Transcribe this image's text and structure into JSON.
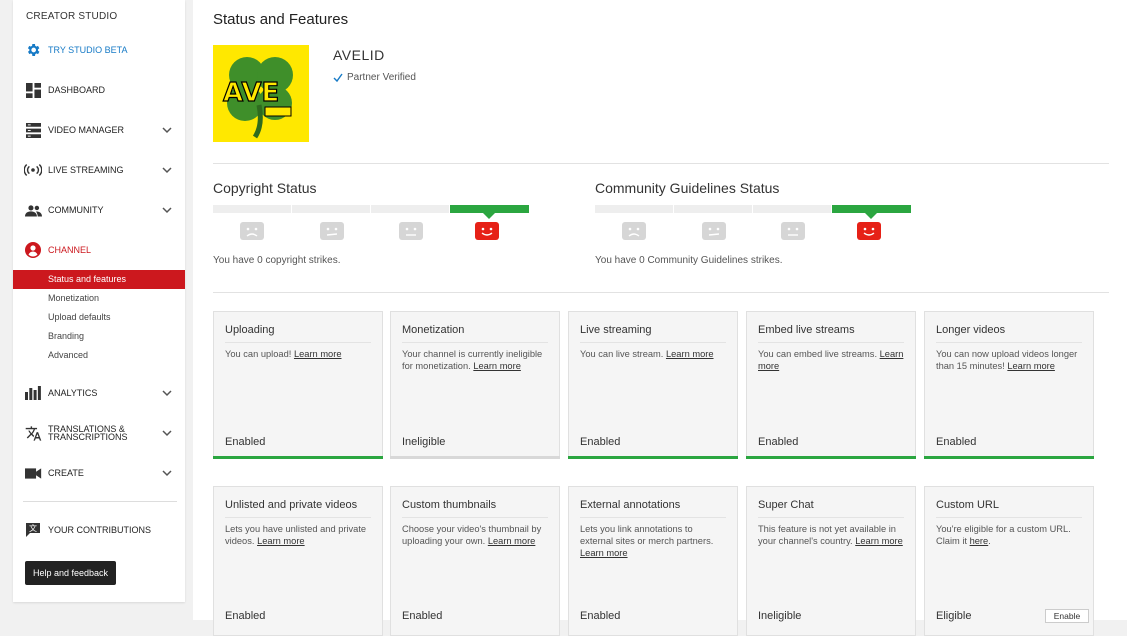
{
  "sidebar": {
    "title": "CREATOR STUDIO",
    "items": [
      {
        "label": "TRY STUDIO BETA",
        "icon": "gear-icon"
      },
      {
        "label": "DASHBOARD",
        "icon": "dashboard-icon"
      },
      {
        "label": "VIDEO MANAGER",
        "icon": "video-manager-icon"
      },
      {
        "label": "LIVE STREAMING",
        "icon": "live-icon"
      },
      {
        "label": "COMMUNITY",
        "icon": "community-icon"
      },
      {
        "label": "CHANNEL",
        "icon": "channel-icon"
      },
      {
        "label": "ANALYTICS",
        "icon": "analytics-icon"
      },
      {
        "label": "TRANSLATIONS &",
        "label2": "TRANSCRIPTIONS",
        "icon": "translate-icon"
      },
      {
        "label": "CREATE",
        "icon": "camera-icon"
      },
      {
        "label": "YOUR CONTRIBUTIONS",
        "icon": "contributions-icon"
      }
    ],
    "channel_sub": [
      "Status and features",
      "Monetization",
      "Upload defaults",
      "Branding",
      "Advanced"
    ],
    "help_label": "Help and feedback"
  },
  "main": {
    "title": "Status and Features",
    "channel_name": "AVELID",
    "verified": "Partner Verified",
    "logo_text": "AVE",
    "copyright": {
      "title": "Copyright Status",
      "text": "You have 0 copyright strikes."
    },
    "community": {
      "title": "Community Guidelines Status",
      "text": "You have 0 Community Guidelines strikes."
    },
    "cards": [
      {
        "title": "Uploading",
        "desc": "You can upload!",
        "link": "Learn more",
        "status": "Enabled"
      },
      {
        "title": "Monetization",
        "desc": "Your channel is currently ineligible for monetization.",
        "link": "Learn more",
        "status": "Ineligible"
      },
      {
        "title": "Live streaming",
        "desc": "You can live stream.",
        "link": "Learn more",
        "status": "Enabled"
      },
      {
        "title": "Embed live streams",
        "desc": "You can embed live streams.",
        "link": "Learn more",
        "status": "Enabled"
      },
      {
        "title": "Longer videos",
        "desc": "You can now upload videos longer than 15 minutes!",
        "link": "Learn more",
        "status": "Enabled"
      },
      {
        "title": "Unlisted and private videos",
        "desc": "Lets you have unlisted and private videos.",
        "link": "Learn more",
        "status": "Enabled"
      },
      {
        "title": "Custom thumbnails",
        "desc": "Choose your video's thumbnail by uploading your own.",
        "link": "Learn more",
        "status": "Enabled"
      },
      {
        "title": "External annotations",
        "desc": "Lets you link annotations to external sites or merch partners.",
        "link": "Learn more",
        "status": "Enabled"
      },
      {
        "title": "Super Chat",
        "desc": "This feature is not yet available in your channel's country.",
        "link": "Learn more",
        "status": "Ineligible"
      },
      {
        "title": "Custom URL",
        "desc": "You're eligible for a custom URL. Claim it",
        "link": "here",
        "desc_after": ".",
        "status": "Eligible",
        "button": "Enable"
      }
    ]
  },
  "colors": {
    "accent_red": "#cc181e",
    "green": "#2ba640",
    "blue": "#167ac6"
  }
}
